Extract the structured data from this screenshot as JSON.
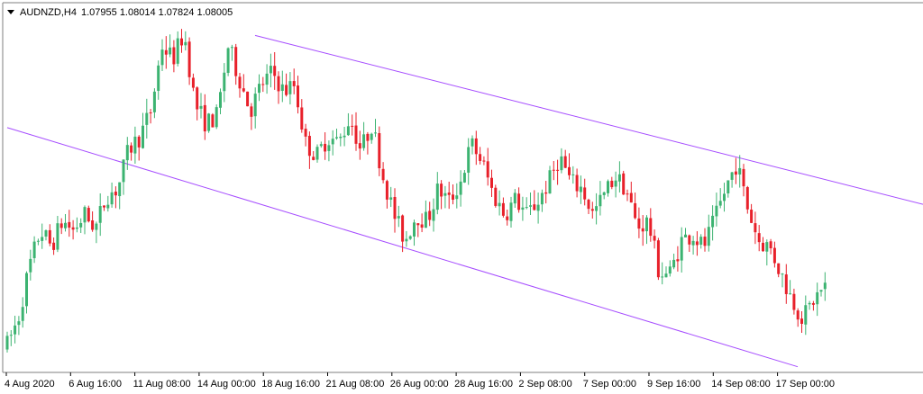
{
  "header": {
    "symbol_timeframe": "AUDNZD,H4",
    "ohlc": "1.07955 1.08014 1.07824 1.08005"
  },
  "colors": {
    "bull": "#3cb371",
    "bear": "#e8202a",
    "channel": "#a64dff",
    "background": "#ffffff",
    "frame": "#7f7f7f"
  },
  "chart_data": {
    "type": "candlestick",
    "symbol": "AUDNZD",
    "timeframe": "H4",
    "x_tick_labels": [
      "4 Aug 2020",
      "6 Aug 16:00",
      "11 Aug 08:00",
      "14 Aug 00:00",
      "18 Aug 16:00",
      "21 Aug 08:00",
      "26 Aug 00:00",
      "28 Aug 16:00",
      "2 Sep 08:00",
      "7 Sep 00:00",
      "9 Sep 16:00",
      "14 Sep 08:00",
      "17 Sep 00:00"
    ],
    "y_range": [
      1.076,
      1.103
    ],
    "price_path": [
      1.078,
      1.08,
      1.084,
      1.0868,
      1.0856,
      1.0875,
      1.0868,
      1.088,
      1.087,
      1.0895,
      1.09,
      1.093,
      1.094,
      1.096,
      1.101,
      1.1,
      1.102,
      1.0965,
      1.095,
      1.0956,
      1.101,
      1.0985,
      1.096,
      1.098,
      1.099,
      1.0975,
      1.098,
      1.0935,
      1.0925,
      1.094,
      1.0935,
      1.0955,
      1.093,
      1.095,
      1.091,
      1.088,
      1.086,
      1.088,
      1.0875,
      1.09,
      1.089,
      1.0905,
      1.0935,
      1.092,
      1.0895,
      1.088,
      1.0892,
      1.088,
      1.089,
      1.0905,
      1.0925,
      1.0905,
      1.09,
      1.088,
      1.0895,
      1.091,
      1.09,
      1.087,
      1.0875,
      1.0835,
      1.0835,
      1.086,
      1.0865,
      1.0855,
      1.0875,
      1.09,
      1.092,
      1.0885,
      1.086,
      1.0855,
      1.0835,
      1.0815,
      1.08,
      1.0815,
      1.0825
    ],
    "channel_upper": {
      "start_price": 1.1018,
      "end_price": 1.0888
    },
    "channel_lower": {
      "start_price": 1.0947,
      "end_price": 1.0763
    }
  }
}
